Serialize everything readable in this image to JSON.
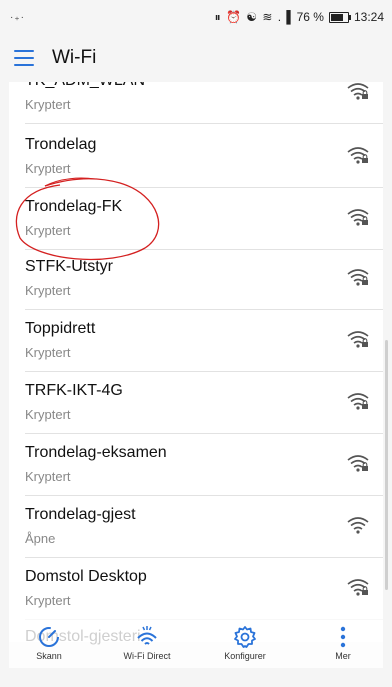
{
  "status_bar": {
    "left_glyph": "·₊·",
    "icons_text": "⏸ ⏰ ☯ ≋ .▐",
    "battery_percent": 76,
    "battery_text": "76 %",
    "time": "13:24"
  },
  "header": {
    "title": "Wi-Fi"
  },
  "accent_color": "#2a73d9",
  "annotation_color": "#d42020",
  "networks": [
    {
      "name": "TK_ADM_WLAN",
      "status": "Kryptert",
      "locked": true
    },
    {
      "name": "Trondelag",
      "status": "Kryptert",
      "locked": true
    },
    {
      "name": "Trondelag-FK",
      "status": "Kryptert",
      "locked": true,
      "circled": true
    },
    {
      "name": "STFK-Utstyr",
      "status": "Kryptert",
      "locked": true
    },
    {
      "name": "Toppidrett",
      "status": "Kryptert",
      "locked": true
    },
    {
      "name": "TRFK-IKT-4G",
      "status": "Kryptert",
      "locked": true
    },
    {
      "name": "Trondelag-eksamen",
      "status": "Kryptert",
      "locked": true
    },
    {
      "name": "Trondelag-gjest",
      "status": "Åpne",
      "locked": false
    },
    {
      "name": "Domstol Desktop",
      "status": "Kryptert",
      "locked": true
    },
    {
      "name": "Domstol-gjesteri",
      "status": "",
      "locked": true
    }
  ],
  "bottom_tabs": [
    {
      "label": "Skann",
      "icon": "scan-icon"
    },
    {
      "label": "Wi-Fi Direct",
      "icon": "wifi-direct-icon"
    },
    {
      "label": "Konfigurer",
      "icon": "gear-icon"
    },
    {
      "label": "Mer",
      "icon": "more-vertical-icon"
    }
  ]
}
